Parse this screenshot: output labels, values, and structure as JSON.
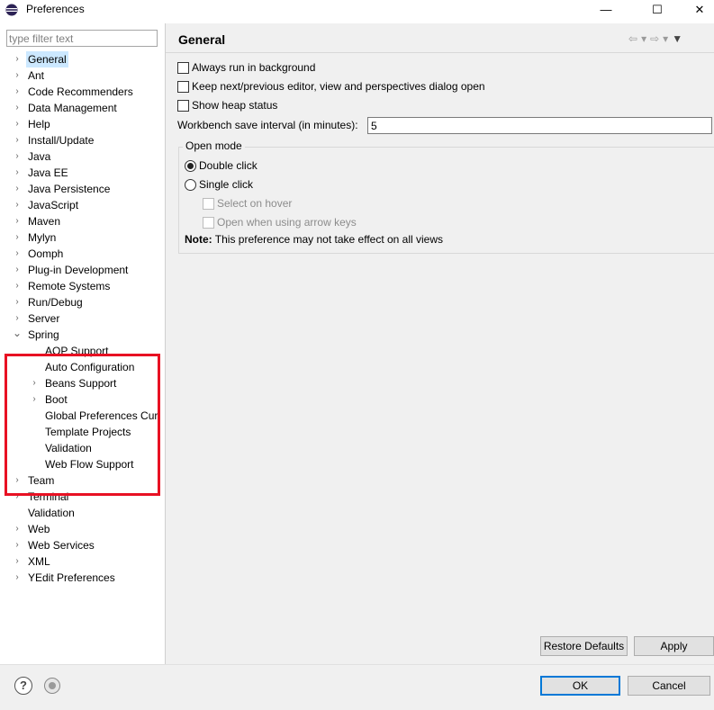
{
  "window": {
    "title": "Preferences",
    "minimize_glyph": "—",
    "maximize_glyph": "☐",
    "close_glyph": "✕"
  },
  "filter": {
    "placeholder": "type filter text",
    "value": ""
  },
  "tree": [
    {
      "label": "General",
      "chevron": "›",
      "selected": true
    },
    {
      "label": "Ant",
      "chevron": "›"
    },
    {
      "label": "Code Recommenders",
      "chevron": "›"
    },
    {
      "label": "Data Management",
      "chevron": "›"
    },
    {
      "label": "Help",
      "chevron": "›"
    },
    {
      "label": "Install/Update",
      "chevron": "›"
    },
    {
      "label": "Java",
      "chevron": "›"
    },
    {
      "label": "Java EE",
      "chevron": "›"
    },
    {
      "label": "Java Persistence",
      "chevron": "›"
    },
    {
      "label": "JavaScript",
      "chevron": "›"
    },
    {
      "label": "Maven",
      "chevron": "›"
    },
    {
      "label": "Mylyn",
      "chevron": "›"
    },
    {
      "label": "Oomph",
      "chevron": "›"
    },
    {
      "label": "Plug-in Development",
      "chevron": "›"
    },
    {
      "label": "Remote Systems",
      "chevron": "›"
    },
    {
      "label": "Run/Debug",
      "chevron": "›"
    },
    {
      "label": "Server",
      "chevron": "›"
    },
    {
      "label": "Spring",
      "chevron": "⌄",
      "expanded": true
    },
    {
      "label": "AOP Support",
      "chevron": "",
      "child": true
    },
    {
      "label": "Auto Configuration",
      "chevron": "",
      "child": true
    },
    {
      "label": "Beans Support",
      "chevron": "›",
      "child": true
    },
    {
      "label": "Boot",
      "chevron": "›",
      "child": true
    },
    {
      "label": "Global Preferences Cur",
      "chevron": "",
      "child": true
    },
    {
      "label": "Template Projects",
      "chevron": "",
      "child": true
    },
    {
      "label": "Validation",
      "chevron": "",
      "child": true
    },
    {
      "label": "Web Flow Support",
      "chevron": "",
      "child": true
    },
    {
      "label": "Team",
      "chevron": "›"
    },
    {
      "label": "Terminal",
      "chevron": "›"
    },
    {
      "label": "Validation",
      "chevron": ""
    },
    {
      "label": "Web",
      "chevron": "›"
    },
    {
      "label": "Web Services",
      "chevron": "›"
    },
    {
      "label": "XML",
      "chevron": "›"
    },
    {
      "label": "YEdit Preferences",
      "chevron": "›"
    }
  ],
  "scroll": {
    "left_arrow": "‹",
    "right_arrow": "›"
  },
  "page": {
    "title": "General",
    "nav": {
      "back": "⇦",
      "back_menu": "▾",
      "forward": "⇨",
      "forward_menu": "▾",
      "view_menu": "▼"
    },
    "checkboxes": [
      {
        "label": "Always run in background",
        "checked": false
      },
      {
        "label": "Keep next/previous editor, view and perspectives dialog open",
        "checked": false
      },
      {
        "label": "Show heap status",
        "checked": false
      }
    ],
    "save_interval_label": "Workbench save interval (in minutes):",
    "save_interval_value": "5",
    "open_mode": {
      "group_title": "Open mode",
      "double_click": "Double click",
      "single_click": "Single click",
      "selected": "double",
      "select_on_hover": "Select on hover",
      "open_arrow_keys": "Open when using arrow keys"
    },
    "note_label": "Note:",
    "note_text": " This preference may not take effect on all views",
    "restore_defaults": "Restore Defaults",
    "apply": "Apply"
  },
  "footer": {
    "help_glyph": "?",
    "ok": "OK",
    "cancel": "Cancel"
  },
  "colors": {
    "highlight_box": "#e81123",
    "selection": "#cce8ff",
    "default_button_border": "#0078d7"
  }
}
